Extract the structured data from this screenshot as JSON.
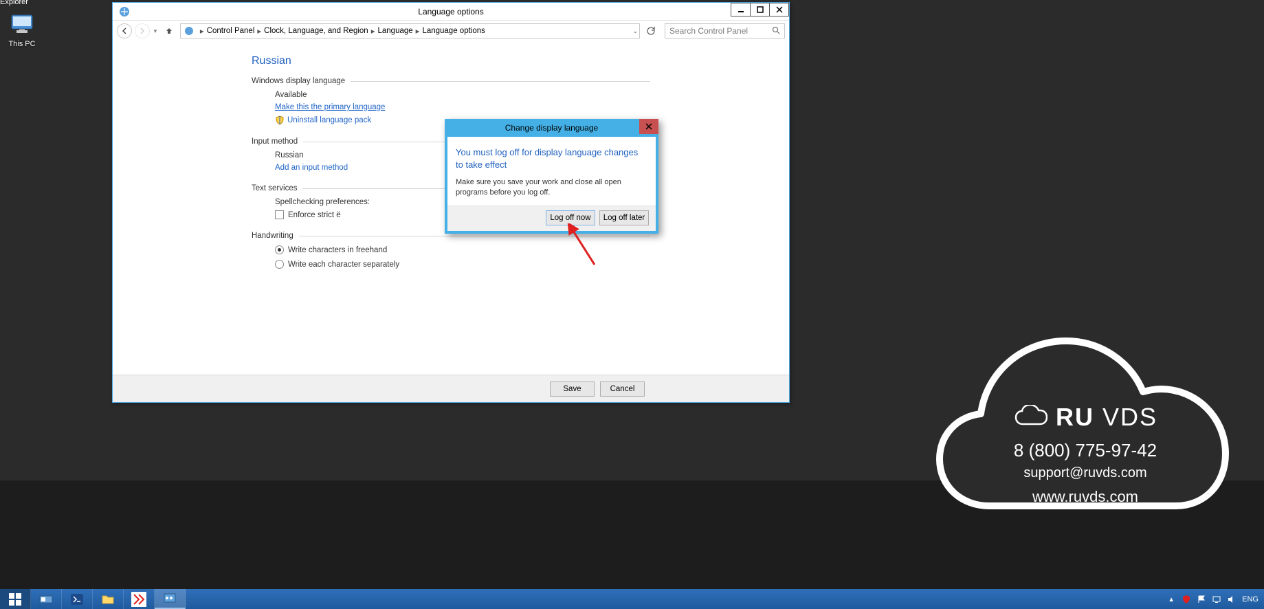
{
  "desktop": {
    "explorer_label": "Explorer",
    "this_pc_label": "This PC"
  },
  "window": {
    "title": "Language options",
    "breadcrumb": {
      "items": [
        "Control Panel",
        "Clock, Language, and Region",
        "Language",
        "Language options"
      ]
    },
    "search_placeholder": "Search Control Panel",
    "content": {
      "lang_title": "Russian",
      "display_lang_header": "Windows display language",
      "available_label": "Available",
      "make_primary_link": "Make this the primary language",
      "uninstall_link": "Uninstall language pack",
      "input_method_header": "Input method",
      "input_method_value": "Russian",
      "add_input_link": "Add an input method",
      "text_services_header": "Text services",
      "spellcheck_label": "Spellchecking preferences:",
      "enforce_e_label": "Enforce strict ё",
      "handwriting_header": "Handwriting",
      "freehand_label": "Write characters in freehand",
      "separate_label": "Write each character separately"
    },
    "footer": {
      "save": "Save",
      "cancel": "Cancel"
    }
  },
  "dialog": {
    "title": "Change display language",
    "headline": "You must log off for display language changes to take effect",
    "body": "Make sure you save your work and close all open programs before you log off.",
    "log_off_now": "Log off now",
    "log_off_later": "Log off later"
  },
  "watermark": {
    "brand_ru": "RU",
    "brand_vds": " VDS",
    "phone": "8 (800) 775-97-42",
    "email": "support@ruvds.com",
    "site": "www.ruvds.com"
  },
  "taskbar": {
    "lang": "ENG"
  }
}
